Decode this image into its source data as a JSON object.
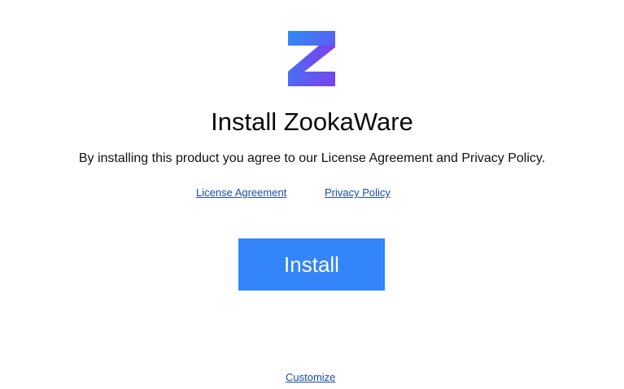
{
  "app": {
    "logo_icon": "zookaware-z-logo-icon",
    "title": "Install ZookaWare",
    "agreement_text": "By installing this product you agree to our License Agreement and Privacy Policy."
  },
  "links": {
    "license": "License Agreement",
    "privacy": "Privacy Policy",
    "customize": "Customize"
  },
  "install_button": {
    "label": "Install"
  },
  "colors": {
    "accent": "#3385f9",
    "link": "#1a4aa8",
    "logo_gradient_start": "#2b8ff5",
    "logo_gradient_end": "#7b3ff0"
  }
}
